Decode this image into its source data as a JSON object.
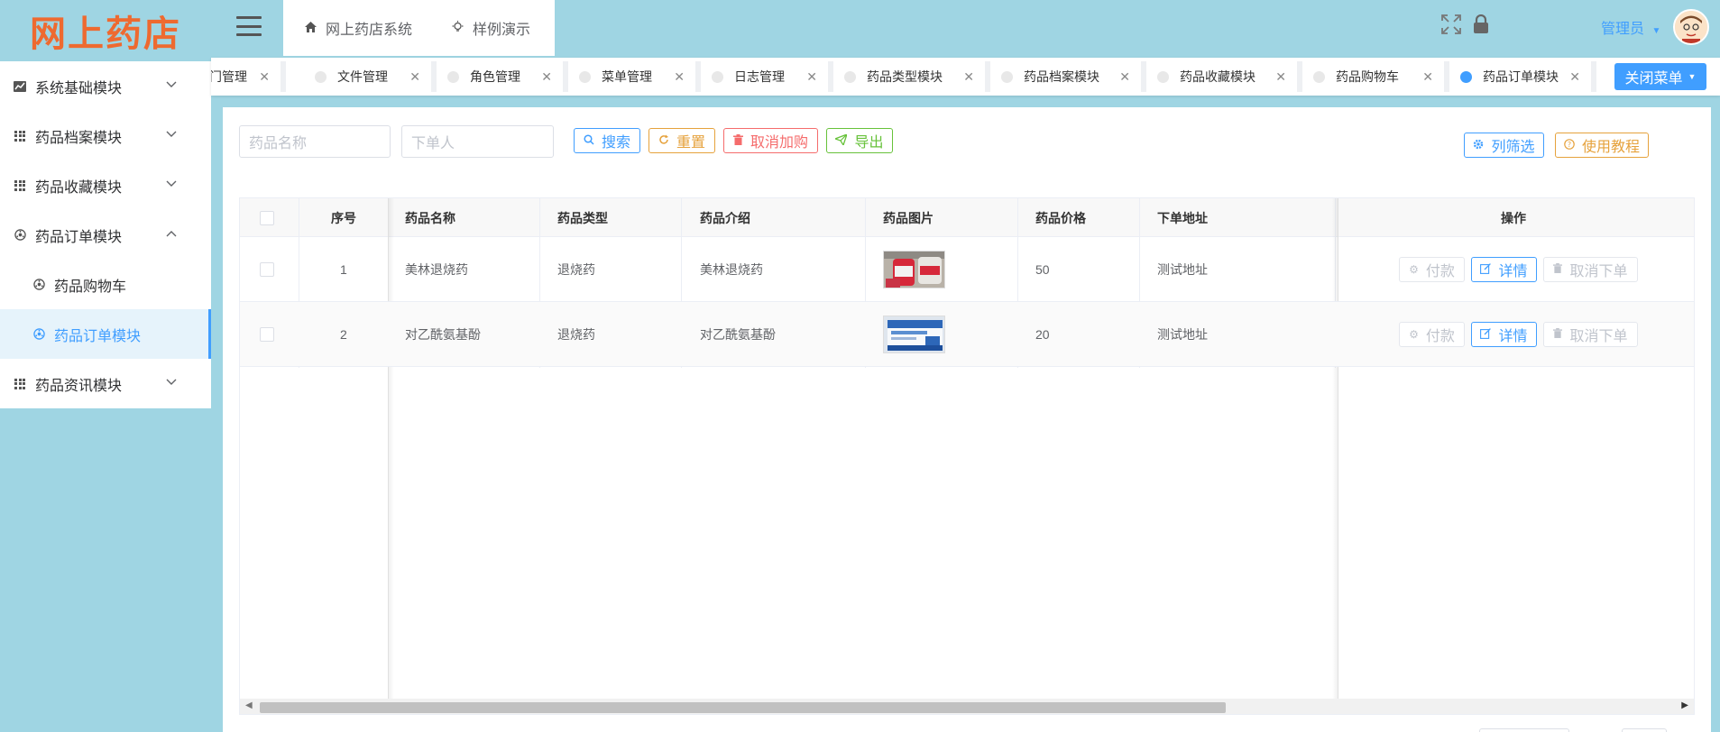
{
  "logo": {
    "text": "网上药店"
  },
  "sidebar": {
    "items": [
      {
        "label": "系统基础模块",
        "icon": "chart-icon",
        "expanded": false
      },
      {
        "label": "药品档案模块",
        "icon": "grid-icon",
        "expanded": false
      },
      {
        "label": "药品收藏模块",
        "icon": "grid-icon",
        "expanded": false
      },
      {
        "label": "药品订单模块",
        "icon": "settings-icon",
        "expanded": true,
        "children": [
          {
            "label": "药品购物车",
            "active": false
          },
          {
            "label": "药品订单模块",
            "active": true
          }
        ]
      },
      {
        "label": "药品资讯模块",
        "icon": "grid-icon",
        "expanded": false
      }
    ]
  },
  "header": {
    "tabs": [
      {
        "label": "网上药店系统",
        "icon": "home-icon"
      },
      {
        "label": "样例演示",
        "icon": "lightbulb-icon"
      }
    ],
    "admin_label": "管理员"
  },
  "tags": [
    {
      "label": "部门管理",
      "active": false
    },
    {
      "label": "文件管理",
      "active": false
    },
    {
      "label": "角色管理",
      "active": false
    },
    {
      "label": "菜单管理",
      "active": false
    },
    {
      "label": "日志管理",
      "active": false
    },
    {
      "label": "药品类型模块",
      "active": false
    },
    {
      "label": "药品档案模块",
      "active": false
    },
    {
      "label": "药品收藏模块",
      "active": false
    },
    {
      "label": "药品购物车",
      "active": false
    },
    {
      "label": "药品订单模块",
      "active": true
    }
  ],
  "close_menu_label": "关闭菜单",
  "search": {
    "name_placeholder": "药品名称",
    "user_placeholder": "下单人",
    "search_label": "搜索",
    "reset_label": "重置",
    "cancel_purchase_label": "取消加购",
    "export_label": "导出",
    "column_filter_label": "列筛选",
    "tutorial_label": "使用教程"
  },
  "table": {
    "headers": {
      "index": "序号",
      "name": "药品名称",
      "type": "药品类型",
      "intro": "药品介绍",
      "image": "药品图片",
      "price": "药品价格",
      "address": "下单地址",
      "ops": "操作"
    },
    "rows": [
      {
        "index": "1",
        "name": "美林退烧药",
        "type": "退烧药",
        "intro": "美林退烧药",
        "price": "50",
        "address": "测试地址"
      },
      {
        "index": "2",
        "name": "对乙酰氨基酚",
        "type": "退烧药",
        "intro": "对乙酰氨基酚",
        "price": "20",
        "address": "测试地址"
      }
    ],
    "ops": {
      "pay": "付款",
      "detail": "详情",
      "cancel_order": "取消下单"
    }
  },
  "colors": {
    "accent": "#409eff",
    "sidebar_bg": "#9fd5e3",
    "logo": "#ee6a30"
  }
}
